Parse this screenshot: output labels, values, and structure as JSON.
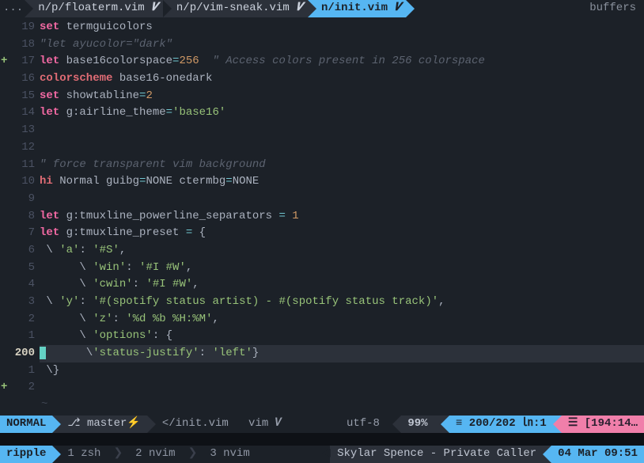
{
  "tabs": {
    "ellipsis": "...",
    "t1": "n/p/floaterm.vim",
    "t2": "n/p/vim-sneak.vim",
    "t3": "n/init.vim",
    "mod": "𝑽",
    "buffers_label": "buffers"
  },
  "gutter": {
    "nums": [
      "19",
      "18",
      "17",
      "16",
      "15",
      "14",
      "13",
      "12",
      "11",
      "10",
      "9",
      "8",
      "7",
      "6",
      "5",
      "4",
      "3",
      "2",
      "1",
      "200",
      "1",
      "2"
    ],
    "plus_rows": [
      2,
      21
    ]
  },
  "code": {
    "l0": {
      "a": "set ",
      "b": "termguicolors"
    },
    "l1": "\"let ayucolor=\"dark\"",
    "l2": {
      "a": "let ",
      "b": "base16colorspace",
      "c": "=",
      "d": "256",
      "e": "  \" Access colors present in 256 colorspace"
    },
    "l3": {
      "a": "colorscheme ",
      "b": "base16-onedark"
    },
    "l4": {
      "a": "set ",
      "b": "showtabline",
      "c": "=",
      "d": "2"
    },
    "l5": {
      "a": "let ",
      "b": "g:airline_theme",
      "c": "=",
      "d": "'base16'"
    },
    "l6": "",
    "l7": "",
    "l8": "\" force transparent vim background",
    "l9": {
      "a": "hi ",
      "b": "Normal guibg",
      "c": "=",
      "d": "NONE ",
      "e": "ctermbg",
      "f": "=",
      "g": "NONE"
    },
    "l10": "",
    "l11": {
      "a": "let ",
      "b": "g:tmuxline_powerline_separators ",
      "c": "= ",
      "d": "1"
    },
    "l12": {
      "a": "let ",
      "b": "g:tmuxline_preset ",
      "c": "= ",
      "d": "{"
    },
    "l13": {
      "a": " \\ ",
      "b": "'a'",
      "c": ": ",
      "d": "'#S'",
      "e": ","
    },
    "l14": {
      "a": "      \\ ",
      "b": "'win'",
      "c": ": ",
      "d": "'#I #W'",
      "e": ","
    },
    "l15": {
      "a": "      \\ ",
      "b": "'cwin'",
      "c": ": ",
      "d": "'#I #W'",
      "e": ","
    },
    "l16": {
      "a": " \\ ",
      "b": "'y'",
      "c": ": ",
      "d": "'#(spotify status artist) - #(spotify status track)'",
      "e": ","
    },
    "l17": {
      "a": "      \\ ",
      "b": "'z'",
      "c": ": ",
      "d": "'%d %b %H:%M'",
      "e": ","
    },
    "l18": {
      "a": "      \\ ",
      "b": "'options'",
      "c": ": ",
      "d": "{"
    },
    "l19": {
      "sp": "      ",
      "a": "\\",
      "b": "'status-justify'",
      "c": ": ",
      "d": "'left'",
      "e": "}"
    },
    "l20": " \\}",
    "l21": ""
  },
  "status": {
    "mode": "NORMAL",
    "branch_icon": "⎇",
    "branch": " master",
    "bolt": "⚡",
    "file": "</init.vim",
    "ft": "vim 𝑽",
    "enc": "utf-8 ",
    "apple": "",
    "percent": "99% ",
    "lines_icon": "≡ ",
    "lines": "200/202 ",
    "col_icon": "㏑",
    "col": ":1",
    "warn_icon": "☰ ",
    "warn": "[194:14…"
  },
  "tmux": {
    "session": "ripple",
    "w1": "1 zsh",
    "w2": "2 nvim",
    "w3": "3 nvim",
    "spotify": "Skylar Spence - Private Caller",
    "clock": "04 Mar 09:51"
  }
}
